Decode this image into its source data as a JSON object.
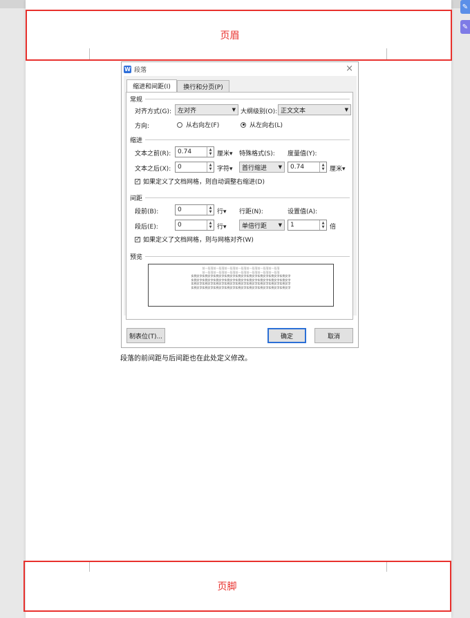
{
  "header_label": "页眉",
  "footer_label": "页脚",
  "caption": "段落的前间距与后间距也在此处定义修改。",
  "colors": {
    "red": "#e8302c",
    "accent": "#2e6fd9",
    "side_icons": [
      "#5b8fe8",
      "#7e7be6"
    ]
  },
  "dialog": {
    "title": "段落",
    "close": "×",
    "tabs": [
      "缩进和间距(I)",
      "换行和分页(P)"
    ],
    "general": {
      "section": "常规",
      "align_label": "对齐方式(G):",
      "align_value": "左对齐",
      "outline_label": "大纲级别(O):",
      "outline_value": "正文文本",
      "direction_label": "方向:",
      "rtl": "从右向左(F)",
      "ltr": "从左向右(L)"
    },
    "indent": {
      "section": "缩进",
      "before_label": "文本之前(R):",
      "before_value": "0.74",
      "before_unit": "厘米▾",
      "special_label": "特殊格式(S):",
      "measure_label": "度量值(Y):",
      "after_label": "文本之后(X):",
      "after_value": "0",
      "after_unit": "字符▾",
      "special_value": "首行缩进",
      "measure_value": "0.74",
      "measure_unit": "厘米▾",
      "auto_adjust": "如果定义了文档网格，则自动调整右缩进(D)"
    },
    "spacing": {
      "section": "间距",
      "before_label": "段前(B):",
      "before_value": "0",
      "before_unit": "行▾",
      "line_label": "行距(N):",
      "setting_label": "设置值(A):",
      "after_label": "段后(E):",
      "after_value": "0",
      "after_unit": "行▾",
      "line_value": "单倍行距",
      "setting_value": "1",
      "setting_unit": "倍",
      "snap_grid": "如果定义了文档网格，则与网格对齐(W)"
    },
    "preview": {
      "section": "预览",
      "prev_line": "前一段落前一段落前一段落前一段落前一段落前一段落前一段落",
      "sample_line": "实例文字实例文字实例文字实例文字实例文字实例文字实例文字实例文字实例文字"
    },
    "buttons": {
      "tabs": "制表位(T)...",
      "ok": "确定",
      "cancel": "取消"
    }
  }
}
